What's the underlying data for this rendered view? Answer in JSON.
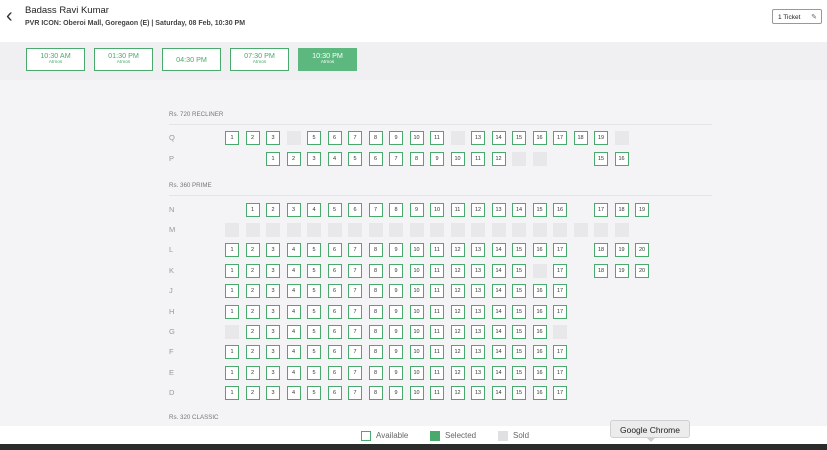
{
  "header": {
    "back_icon": "chevron-left-icon",
    "title": "Badass Ravi Kumar",
    "subtitle": "PVR ICON: Oberoi Mall, Goregaon (E) | Saturday, 08 Feb, 10:30 PM",
    "ticket_label": "1 Ticket",
    "edit_icon": "pencil-icon"
  },
  "showtimes": [
    {
      "time": "10:30 AM",
      "format": "Atmos",
      "active": false
    },
    {
      "time": "01:30 PM",
      "format": "Atmos",
      "active": false
    },
    {
      "time": "04:30 PM",
      "format": "",
      "active": false
    },
    {
      "time": "07:30 PM",
      "format": "Atmos",
      "active": false
    },
    {
      "time": "10:30 PM",
      "format": "Atmos",
      "active": true
    }
  ],
  "categories": [
    {
      "label": "Rs. 720 RECLINER"
    },
    {
      "label": "Rs. 360 PRIME"
    },
    {
      "label": "Rs. 320 CLASSIC"
    }
  ],
  "rows": {
    "Q": {
      "label": "Q",
      "seats": [
        "1",
        "2",
        "3",
        "S:4",
        "5",
        "6",
        "7",
        "8",
        "9",
        "10",
        "11",
        "S:12",
        "13",
        "14",
        "15",
        "16",
        "17",
        "18",
        "19",
        "S:20"
      ]
    },
    "P": {
      "label": "P",
      "seats": [
        "1",
        "2",
        "3",
        "4",
        "5",
        "6",
        "7",
        "8",
        "9",
        "10",
        "11",
        "12",
        "S:13",
        "S:14",
        "15",
        "16"
      ]
    },
    "N": {
      "label": "N",
      "seats": [
        "1",
        "2",
        "3",
        "4",
        "5",
        "6",
        "7",
        "8",
        "9",
        "10",
        "11",
        "12",
        "13",
        "14",
        "15",
        "16",
        "17",
        "18",
        "19"
      ]
    },
    "M": {
      "label": "M",
      "seats": [
        "S:1",
        "S:2",
        "S:3",
        "S:4",
        "S:5",
        "S:6",
        "S:7",
        "S:8",
        "S:9",
        "S:10",
        "S:11",
        "S:12",
        "S:13",
        "S:14",
        "S:15",
        "S:16",
        "S:17",
        "S:18",
        "S:19",
        "S:20"
      ]
    },
    "L": {
      "label": "L",
      "seats": [
        "1",
        "2",
        "3",
        "4",
        "5",
        "6",
        "7",
        "8",
        "9",
        "10",
        "11",
        "12",
        "13",
        "14",
        "15",
        "16",
        "17",
        "18",
        "19",
        "20"
      ]
    },
    "K": {
      "label": "K",
      "seats": [
        "1",
        "2",
        "3",
        "4",
        "5",
        "6",
        "7",
        "8",
        "9",
        "10",
        "11",
        "12",
        "13",
        "14",
        "15",
        "S:16",
        "17",
        "18",
        "19",
        "20"
      ]
    },
    "J": {
      "label": "J",
      "seats": [
        "1",
        "2",
        "3",
        "4",
        "5",
        "6",
        "7",
        "8",
        "9",
        "10",
        "11",
        "12",
        "13",
        "14",
        "15",
        "16",
        "17"
      ]
    },
    "H": {
      "label": "H",
      "seats": [
        "1",
        "2",
        "3",
        "4",
        "5",
        "6",
        "7",
        "8",
        "9",
        "10",
        "11",
        "12",
        "13",
        "14",
        "15",
        "16",
        "17"
      ]
    },
    "G": {
      "label": "G",
      "seats": [
        "S:1",
        "2",
        "3",
        "4",
        "5",
        "6",
        "7",
        "8",
        "9",
        "10",
        "11",
        "12",
        "13",
        "14",
        "15",
        "16",
        "S:17"
      ]
    },
    "F": {
      "label": "F",
      "seats": [
        "1",
        "2",
        "3",
        "4",
        "5",
        "6",
        "7",
        "8",
        "9",
        "10",
        "11",
        "12",
        "13",
        "14",
        "15",
        "16",
        "17"
      ]
    },
    "E": {
      "label": "E",
      "seats": [
        "1",
        "2",
        "3",
        "4",
        "5",
        "6",
        "7",
        "8",
        "9",
        "10",
        "11",
        "12",
        "13",
        "14",
        "15",
        "16",
        "17"
      ]
    },
    "D": {
      "label": "D",
      "seats": [
        "1",
        "2",
        "3",
        "4",
        "5",
        "6",
        "7",
        "8",
        "9",
        "10",
        "11",
        "12",
        "13",
        "14",
        "15",
        "16",
        "17"
      ]
    }
  },
  "legend": {
    "available": "Available",
    "selected": "Selected",
    "sold": "Sold"
  },
  "tooltip": "Google Chrome",
  "colors": {
    "accent": "#4aa96c",
    "active_showtime": "#5cb87e",
    "sold": "#e8e8ea"
  }
}
